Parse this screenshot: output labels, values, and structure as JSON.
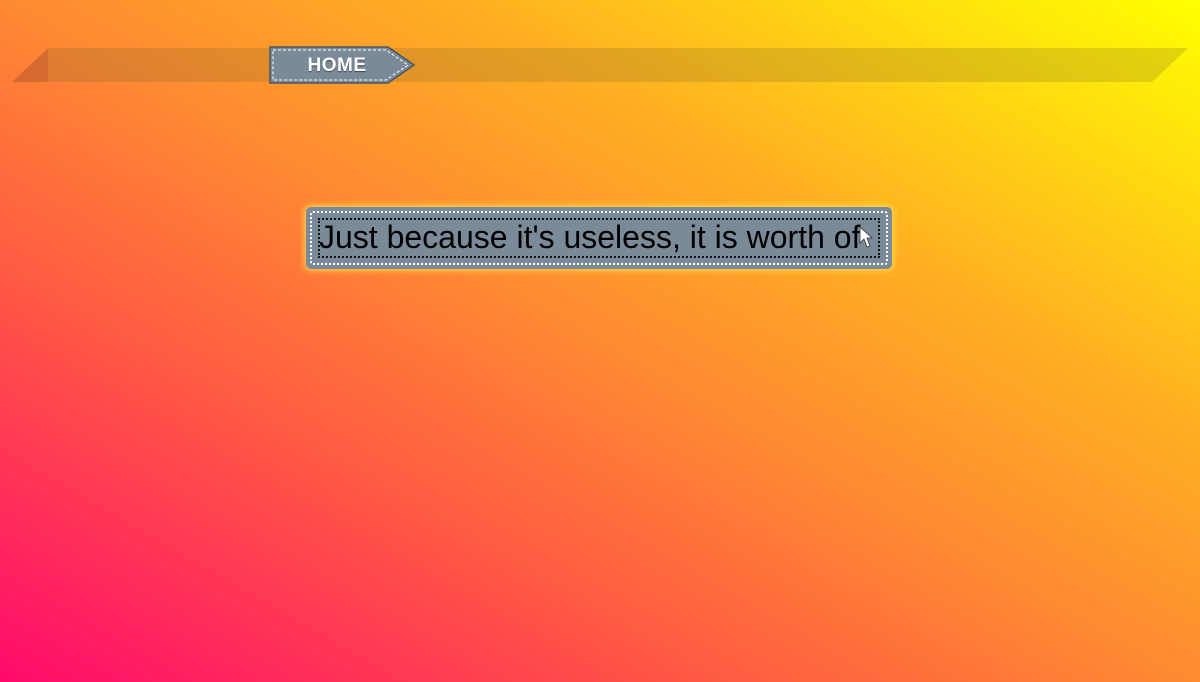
{
  "nav": {
    "home_label": "HOME"
  },
  "main": {
    "quote_text": "Just because it's useless, it is worth of",
    "cursor_icon": "text-cursor-icon"
  },
  "colors": {
    "gradient_start": "#ff0a6c",
    "gradient_end": "#ffff00",
    "tab_fill": "#7a8a99",
    "box_fill": "#7a8a99",
    "glow": "#ffdc50"
  }
}
